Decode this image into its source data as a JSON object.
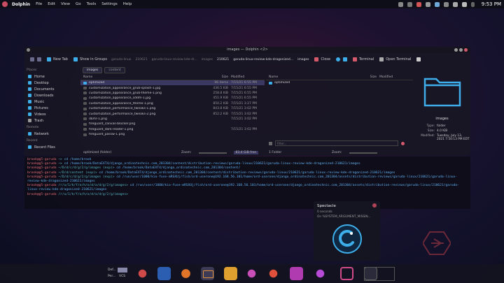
{
  "top_panel": {
    "app_name": "Dolphin",
    "menus": [
      "File",
      "Edit",
      "View",
      "Go",
      "Tools",
      "Settings",
      "Help"
    ],
    "clock": "9:53 PM"
  },
  "dolphin": {
    "window_title": "images — Dolphin <2>",
    "toolbar": {
      "new_tab": "New Tab",
      "show_in_groups": "Show in Groups",
      "close": "Close",
      "terminal": "Terminal",
      "open_terminal": "Open Terminal"
    },
    "breadcrumbs": [
      "garuda-linux",
      "210621",
      "garuda-linux-review-kde-dr...",
      "images",
      "210621",
      "garuda-linux-review-kde-dragonized...",
      "images"
    ],
    "places": {
      "places_label": "Places",
      "items": [
        "Home",
        "Desktop",
        "Documents",
        "Downloads",
        "Music",
        "Pictures",
        "Videos",
        "Trash"
      ],
      "remote_label": "Remote",
      "remote_items": [
        "Network"
      ],
      "recent_label": "Recent",
      "recent_items": [
        "Recent Files"
      ]
    },
    "left_pane": {
      "tabs": [
        "images",
        "content"
      ],
      "columns": {
        "name": "Name",
        "size": "Size",
        "modified": "Modified"
      },
      "files": [
        {
          "name": "optimized",
          "size": "96 items",
          "modified": "7/15/21 6:55 PM"
        },
        {
          "name": "customization_appearance_grub-splash-1.jpg",
          "size": "436.5 KiB",
          "modified": "7/15/21 6:55 PM"
        },
        {
          "name": "customization_appearance_grub-theme-1.png",
          "size": "258.8 KiB",
          "modified": "7/15/21 6:55 PM"
        },
        {
          "name": "customization_appearance_sddm-1.jpg",
          "size": "451.9 KiB",
          "modified": "7/15/21 6:55 PM"
        },
        {
          "name": "customization_appearance_theme-1.png",
          "size": "850.2 KiB",
          "modified": "7/15/21 3:27 PM"
        },
        {
          "name": "customization_performance_tweaks-1.png",
          "size": "843.8 KiB",
          "modified": "7/15/21 3:02 PM"
        },
        {
          "name": "customization_performance_tweaks-2.png",
          "size": "852.2 KiB",
          "modified": "7/15/21 3:02 PM"
        },
        {
          "name": "dkmr-1.png",
          "size": "",
          "modified": "7/15/21 3:02 PM"
        },
        {
          "name": "fireguard_canvas-blocker.png",
          "size": "",
          "modified": ""
        },
        {
          "name": "fireguard_dark-reader-1.png",
          "size": "",
          "modified": "7/15/21 3:02 PM"
        },
        {
          "name": "fireguard_passw-1.png",
          "size": "",
          "modified": ""
        }
      ],
      "status": "optimized (folder)",
      "zoom_label": "Zoom:",
      "free": "83.4 GiB free"
    },
    "right_pane": {
      "columns": {
        "name": "Name",
        "size": "Size",
        "modified": "Modified"
      },
      "files": [
        {
          "name": "optimized",
          "size": "",
          "modified": ""
        }
      ],
      "status": "1 Folder",
      "zoom_label": "Zoom:",
      "filter_placeholder": "Filter..."
    },
    "info_panel": {
      "name": "images",
      "type_label": "Type:",
      "type_value": "folder",
      "size_label": "Size:",
      "size_value": "4.0 KiB",
      "modified_label": "Modified:",
      "modified_value": "Tuesday, July 13, 2021 7:50:13 PM EDT"
    }
  },
  "terminal": {
    "lines": [
      {
        "user": "brook@g5-garuda",
        "path": "~>",
        "cmd": "cd /home/brook"
      },
      {
        "user": "brook@g5-garuda",
        "path": "~>",
        "cmd": "cd /home/brook/DataEXT4/django_ordinatechnic.com_201304/content/distribution-reviews/garuda-linux/210621/garuda-linux-review-kde-dragonized-210621/images"
      },
      {
        "user": "brook@g5-garuda",
        "path": "~/D/d/c/d/g/2/g/images (exp)>",
        "cmd": "cd /home/brook/DataEXT4/django_ordinatechnic.com_201304/content/"
      },
      {
        "user": "brook@g5-garuda",
        "path": "~/D/d/content (exp)>",
        "cmd": "cd /home/brook/DataEXT4/django_ordinatechnic.com_201304/content/distribution-reviews/garuda-linux/210621/garuda-linux-review-kde-dragonized-210621/images"
      },
      {
        "user": "brook@g5-garuda",
        "path": "~/D/d/c/d/g/2/g/images (exp)>",
        "cmd": "cd /run/user/1000/kio-fuse-mRSXUj/fish/ord-userone@192.168.56.101/home/ord-userone/django_ordinatechnic.com_201304/assets/distribution-reviews/garuda-linux/210621/garuda-linux-review-kde-dragonized-210621/images"
      },
      {
        "user": "brook@g5-garuda",
        "path": "/r/u/1/k/f/o/h/o/d/a/d/g/2/g/images>",
        "cmd": "cd /run/user/1000/kio-fuse-mRSXUj/fish/ord-userone@192.168.56.101/home/ord-userone/django_ordinatechnic.com_201304/assets/distribution-reviews/garuda-linux/210621/garuda-linux-review-kde-dragonized-210621/images"
      },
      {
        "user": "brook@g5-garuda",
        "path": "/r/u/1/k/f/o/h/o/d/a/d/g/2/g/images>",
        "cmd": ""
      }
    ]
  },
  "spectacle": {
    "title": "Spectacle",
    "subtitle": "0 seconds",
    "detail": "On %SYSTEM_ARGUMENT_MISSIN..."
  },
  "taskbar": {
    "labels": [
      "Def...",
      "Per...",
      "VCS"
    ]
  },
  "colors": {
    "accent": "#3daee9",
    "selection": "#3a3860",
    "terminal_user": "#e06c75",
    "terminal_path": "#56b6c2",
    "terminal_cmd": "#61afef"
  }
}
